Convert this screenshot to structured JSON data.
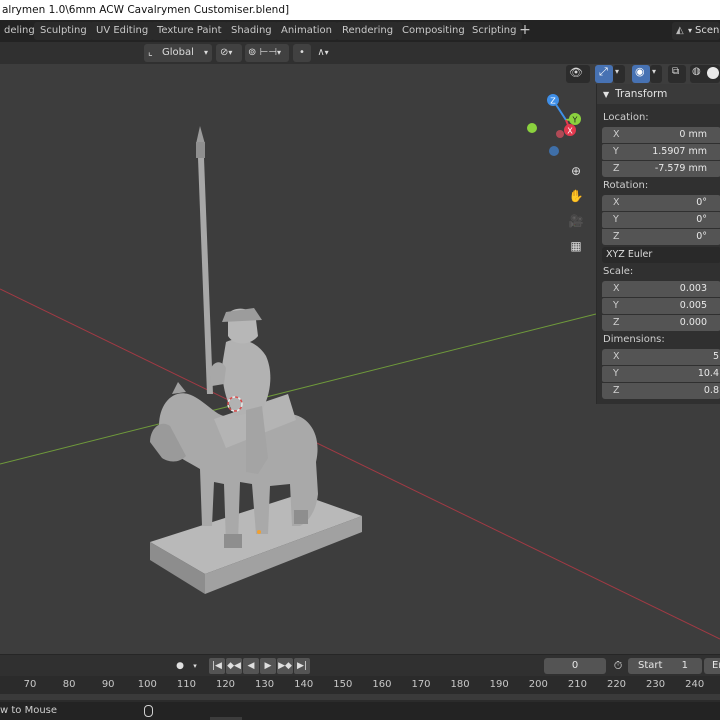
{
  "window": {
    "title": "alrymen 1.0\\6mm ACW Cavalrymen Customiser.blend]"
  },
  "workspace_tabs": [
    {
      "label": "deling"
    },
    {
      "label": "Sculpting"
    },
    {
      "label": "UV Editing"
    },
    {
      "label": "Texture Paint"
    },
    {
      "label": "Shading"
    },
    {
      "label": "Animation"
    },
    {
      "label": "Rendering"
    },
    {
      "label": "Compositing"
    },
    {
      "label": "Scripting"
    }
  ],
  "add_workspace_label": "+",
  "scene_label": "Scen",
  "viewport_header": {
    "transform_orientation": "Global"
  },
  "gizmo": {
    "x": "X",
    "y": "Y",
    "z": "Z",
    "colors": {
      "x": "#e2394e",
      "y": "#8bd23e",
      "z": "#3f8fe8"
    }
  },
  "transform_panel": {
    "title": "Transform",
    "location_label": "Location:",
    "location": [
      {
        "axis": "X",
        "value": "0 mm"
      },
      {
        "axis": "Y",
        "value": "1.5907 mm"
      },
      {
        "axis": "Z",
        "value": "-7.579 mm"
      }
    ],
    "rotation_label": "Rotation:",
    "rotation": [
      {
        "axis": "X",
        "value": "0°"
      },
      {
        "axis": "Y",
        "value": "0°"
      },
      {
        "axis": "Z",
        "value": "0°"
      }
    ],
    "rotation_mode": "XYZ Euler",
    "scale_label": "Scale:",
    "scale": [
      {
        "axis": "X",
        "value": "0.003"
      },
      {
        "axis": "Y",
        "value": "0.005"
      },
      {
        "axis": "Z",
        "value": "0.000"
      }
    ],
    "dimensions_label": "Dimensions:",
    "dimensions": [
      {
        "axis": "X",
        "value": "5"
      },
      {
        "axis": "Y",
        "value": "10.4"
      },
      {
        "axis": "Z",
        "value": "0.8"
      }
    ]
  },
  "playback": {
    "current_frame": "0",
    "start_label": "Start",
    "start_value": "1",
    "end_label": "En"
  },
  "timeline_ticks": [
    "70",
    "80",
    "90",
    "100",
    "110",
    "120",
    "130",
    "140",
    "150",
    "160",
    "170",
    "180",
    "190",
    "200",
    "210",
    "220",
    "230",
    "240"
  ],
  "status_bar": {
    "hint": "w to Mouse"
  }
}
